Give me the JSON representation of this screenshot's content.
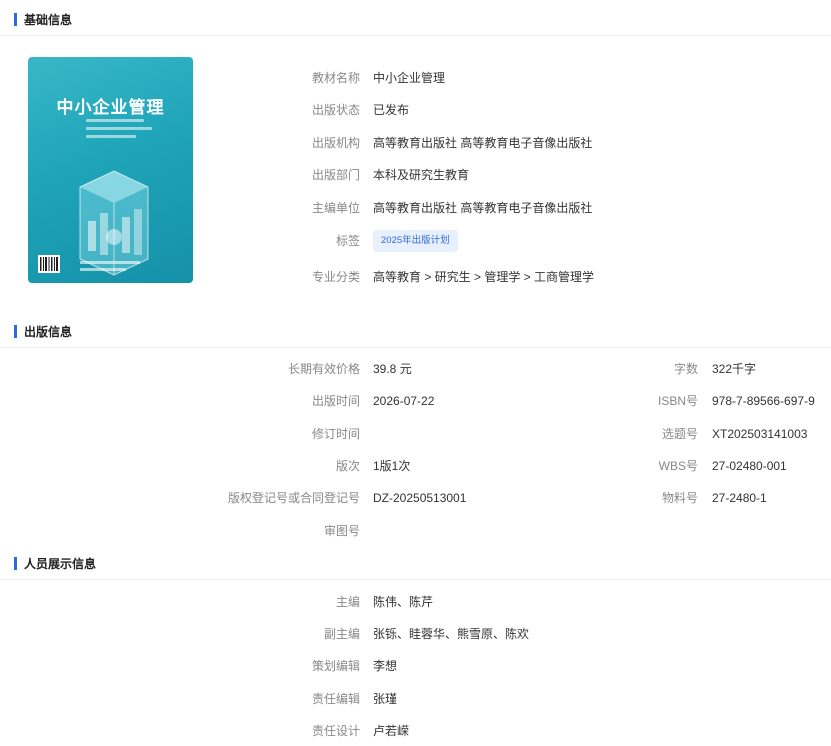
{
  "sections": {
    "basic": "基础信息",
    "publish": "出版信息",
    "people": "人员展示信息"
  },
  "cover": {
    "title": "中小企业管理"
  },
  "basic_info": [
    {
      "label": "教材名称",
      "value": "中小企业管理"
    },
    {
      "label": "出版状态",
      "value": "已发布"
    },
    {
      "label": "出版机构",
      "value": "高等教育出版社 高等教育电子音像出版社"
    },
    {
      "label": "出版部门",
      "value": "本科及研究生教育"
    },
    {
      "label": "主编单位",
      "value": "高等教育出版社 高等教育电子音像出版社"
    },
    {
      "label": "标签",
      "value": "2025年出版计划"
    },
    {
      "label": "专业分类",
      "value": "高等教育 > 研究生 > 管理学 > 工商管理学"
    }
  ],
  "publish_info": {
    "left": [
      {
        "label": "长期有效价格",
        "value": "39.8 元"
      },
      {
        "label": "出版时间",
        "value": "2026-07-22"
      },
      {
        "label": "修订时间",
        "value": ""
      },
      {
        "label": "版次",
        "value": "1版1次"
      },
      {
        "label": "版权登记号或合同登记号",
        "value": "DZ-20250513001"
      },
      {
        "label": "审图号",
        "value": ""
      }
    ],
    "right": [
      {
        "label": "字数",
        "value": "322千字"
      },
      {
        "label": "ISBN号",
        "value": "978-7-89566-697-9"
      },
      {
        "label": "选题号",
        "value": "XT202503141003"
      },
      {
        "label": "WBS号",
        "value": "27-02480-001"
      },
      {
        "label": "物料号",
        "value": "27-2480-1"
      }
    ]
  },
  "people_info": [
    {
      "label": "主编",
      "value": "陈伟、陈芹"
    },
    {
      "label": "副主编",
      "value": "张铄、眭蓉华、熊雪原、陈欢"
    },
    {
      "label": "策划编辑",
      "value": "李想"
    },
    {
      "label": "责任编辑",
      "value": "张瑾"
    },
    {
      "label": "责任设计",
      "value": "卢若嵘"
    }
  ],
  "colors": {
    "accent": "#2f6bdc",
    "label": "#888888",
    "text": "#333333",
    "cover": "#1fa4b8"
  },
  "icons": [
    "barcode-icon"
  ]
}
